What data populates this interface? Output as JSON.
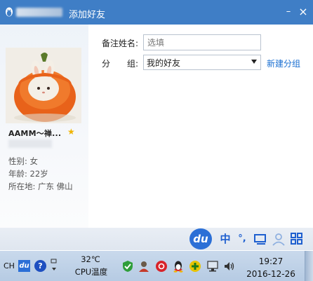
{
  "window": {
    "title": "添加好友",
    "controls": {
      "minimize": "–",
      "close": "×"
    }
  },
  "profile": {
    "nickname": "AAMM～禅...",
    "gender": "性别: 女",
    "age": "年龄: 22岁",
    "location": "所在地: 广东  佛山",
    "favorite_icon": "star-icon"
  },
  "form": {
    "note_label": "备注姓名:",
    "note_placeholder": "选填",
    "group_label_1": "分",
    "group_label_2": "组:",
    "group_value": "我的好友",
    "new_group_link": "新建分组"
  },
  "ime": {
    "logo": "du",
    "mode": "中",
    "punct": "°,",
    "icons": [
      "keyboard-icon",
      "user-icon",
      "grid-icon"
    ]
  },
  "taskbar": {
    "lang": "CH",
    "baidu": "du",
    "help": "?",
    "temp": "32℃",
    "temp_label": "CPU温度",
    "time": "19:27",
    "date": "2016-12-26"
  },
  "colors": {
    "titlebar": "#3f7ec6",
    "link": "#1a6fd1",
    "accent": "#1e5fcf"
  }
}
